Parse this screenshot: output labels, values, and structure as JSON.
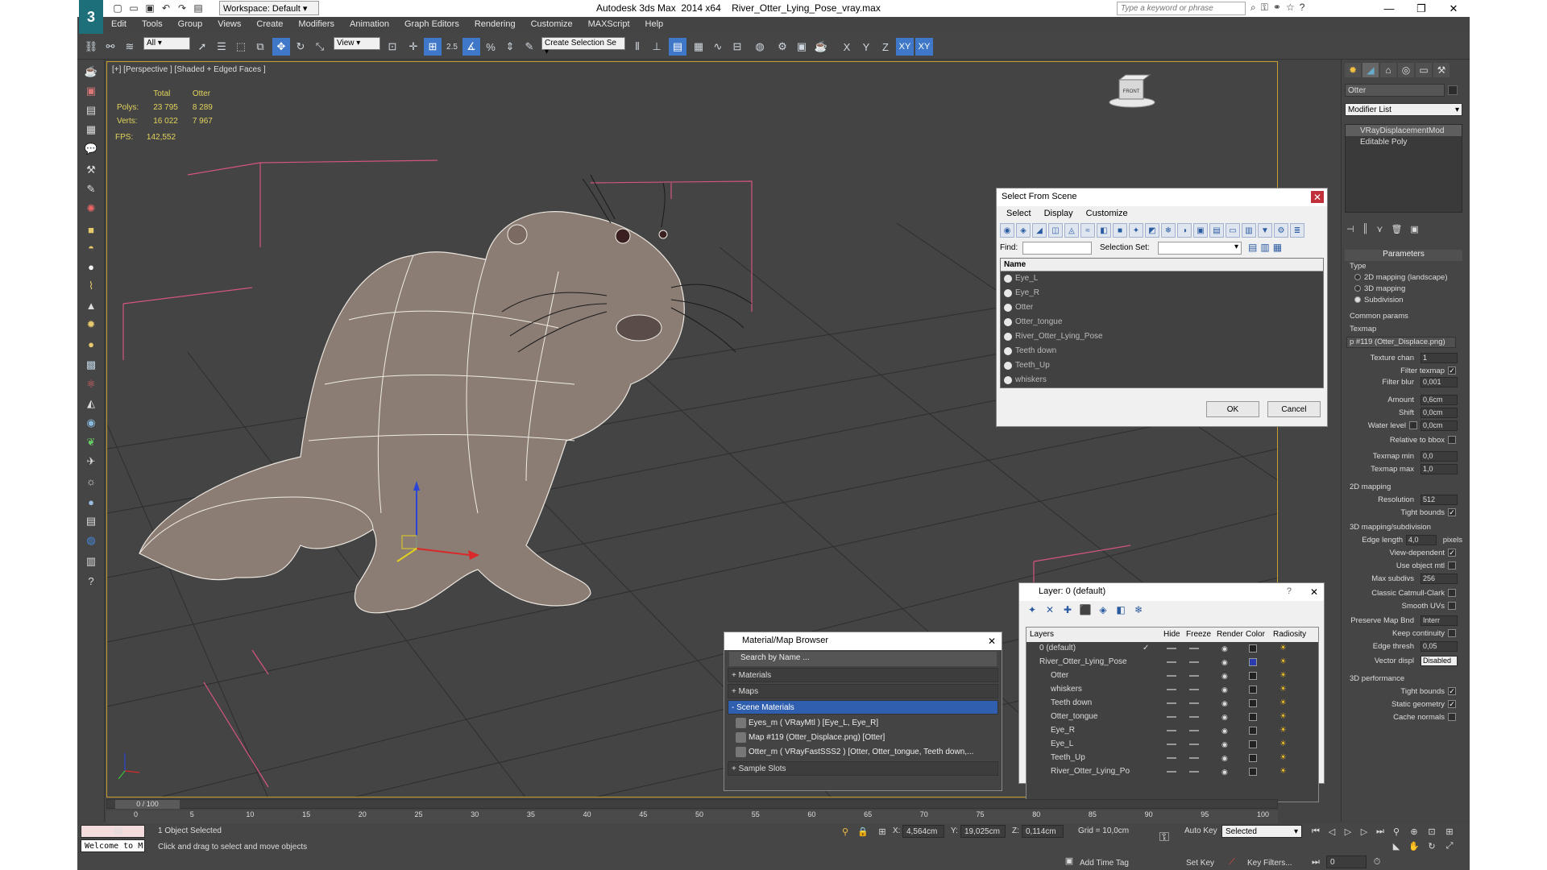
{
  "app": {
    "title": "Autodesk 3ds Max  2014 x64    River_Otter_Lying_Pose_vray.max",
    "workspace": "Workspace: Default",
    "search_placeholder": "Type a keyword or phrase",
    "logo": "3"
  },
  "menu": [
    "Edit",
    "Tools",
    "Group",
    "Views",
    "Create",
    "Modifiers",
    "Animation",
    "Graph Editors",
    "Rendering",
    "Customize",
    "MAXScript",
    "Help"
  ],
  "toolbar": {
    "filter_select": "All",
    "coord_select": "View",
    "selection_set": "Create Selection Se",
    "snap_label": "2.5",
    "axes": [
      "X",
      "Y",
      "Z",
      "XY",
      "XY"
    ]
  },
  "viewport": {
    "label": "[+] [Perspective ] [Shaded + Edged Faces ]",
    "stats_headers": [
      "Total",
      "Otter"
    ],
    "stats": [
      {
        "label": "Polys:",
        "total": "23 795",
        "sel": "8 289"
      },
      {
        "label": "Verts:",
        "total": "16 022",
        "sel": "7 967"
      }
    ],
    "fps_label": "FPS:",
    "fps_value": "142,552",
    "viewcube_label": "FRONT"
  },
  "select_from_scene": {
    "title": "Select From Scene",
    "menu": [
      "Select",
      "Display",
      "Customize"
    ],
    "find_label": "Find:",
    "selset_label": "Selection Set:",
    "column": "Name",
    "items": [
      "Eye_L",
      "Eye_R",
      "Otter",
      "Otter_tongue",
      "River_Otter_Lying_Pose",
      "Teeth down",
      "Teeth_Up",
      "whiskers"
    ],
    "ok": "OK",
    "cancel": "Cancel"
  },
  "material_browser": {
    "title": "Material/Map Browser",
    "search": "Search by Name ...",
    "groups": [
      "+ Materials",
      "+ Maps",
      "- Scene Materials"
    ],
    "items": [
      "Eyes_m  ( VRayMtl ) [Eye_L, Eye_R]",
      "Map #119 (Otter_Displace.png) [Otter]",
      "Otter_m  ( VRayFastSSS2 ) [Otter, Otter_tongue, Teeth down,..."
    ],
    "sample_slots": "+ Sample Slots"
  },
  "layer_dialog": {
    "title": "Layer: 0 (default)",
    "help": "?",
    "columns": [
      "Layers",
      "Hide",
      "Freeze",
      "Render",
      "Color",
      "Radiosity"
    ],
    "rows": [
      {
        "name": "0 (default)",
        "indent": 0,
        "check": "✓",
        "color": "#222222"
      },
      {
        "name": "River_Otter_Lying_Pose",
        "indent": 0,
        "check": "",
        "color": "#2b3bb0"
      },
      {
        "name": "Otter",
        "indent": 1,
        "check": "",
        "color": "#222222"
      },
      {
        "name": "whiskers",
        "indent": 1,
        "check": "",
        "color": "#222222"
      },
      {
        "name": "Teeth down",
        "indent": 1,
        "check": "",
        "color": "#222222"
      },
      {
        "name": "Otter_tongue",
        "indent": 1,
        "check": "",
        "color": "#222222"
      },
      {
        "name": "Eye_R",
        "indent": 1,
        "check": "",
        "color": "#222222"
      },
      {
        "name": "Eye_L",
        "indent": 1,
        "check": "",
        "color": "#222222"
      },
      {
        "name": "Teeth_Up",
        "indent": 1,
        "check": "",
        "color": "#222222"
      },
      {
        "name": "River_Otter_Lying_Po",
        "indent": 1,
        "check": "",
        "color": "#222222"
      }
    ]
  },
  "command_panel": {
    "object_name": "Otter",
    "modifier_list": "Modifier List",
    "stack": [
      "VRayDisplacementMod",
      "Editable Poly"
    ],
    "params_title": "Parameters",
    "type_label": "Type",
    "types": [
      {
        "label": "2D mapping (landscape)",
        "on": false
      },
      {
        "label": "3D mapping",
        "on": false
      },
      {
        "label": "Subdivision",
        "on": true
      }
    ],
    "common_params": "Common params",
    "texmap_label": "Texmap",
    "texmap_value": "p #119 (Otter_Displace.png)",
    "texture_chan": {
      "label": "Texture chan",
      "value": "1"
    },
    "filter_texmap": {
      "label": "Filter texmap",
      "checked": true
    },
    "filter_blur": {
      "label": "Filter blur",
      "value": "0,001"
    },
    "amount": {
      "label": "Amount",
      "value": "0,6cm"
    },
    "shift": {
      "label": "Shift",
      "value": "0,0cm"
    },
    "water_level": {
      "label": "Water level",
      "value": "0,0cm"
    },
    "relative_bbox": {
      "label": "Relative to bbox",
      "checked": false
    },
    "texmap_min": {
      "label": "Texmap min",
      "value": "0,0"
    },
    "texmap_max": {
      "label": "Texmap max",
      "value": "1,0"
    },
    "mapping2d": "2D mapping",
    "resolution": {
      "label": "Resolution",
      "value": "512"
    },
    "tight_bounds": {
      "label": "Tight bounds",
      "checked": true
    },
    "mapping3d": "3D mapping/subdivision",
    "edge_length": {
      "label": "Edge length",
      "value": "4,0",
      "unit": "pixels"
    },
    "view_dependent": {
      "label": "View-dependent",
      "checked": true
    },
    "use_object_mtl": {
      "label": "Use object mtl",
      "checked": false
    },
    "max_subdivs": {
      "label": "Max subdivs",
      "value": "256"
    },
    "catmull": {
      "label": "Classic Catmull-Clark",
      "checked": false
    },
    "smooth_uvs": {
      "label": "Smooth UVs",
      "checked": false
    },
    "preserve_map": {
      "label": "Preserve Map Bnd",
      "value": "Interr"
    },
    "keep_continuity": {
      "label": "Keep continuity",
      "checked": false
    },
    "edge_thresh": {
      "label": "Edge thresh",
      "value": "0,05"
    },
    "vector_displ": {
      "label": "Vector displ",
      "value": "Disabled"
    },
    "perf": "3D performance",
    "tight_bounds2": {
      "label": "Tight bounds",
      "checked": true
    },
    "static_geometry": {
      "label": "Static geometry",
      "checked": true
    },
    "cache_normals": {
      "label": "Cache normals",
      "checked": false
    }
  },
  "timeline": {
    "slider": "0 / 100",
    "ticks": [
      "0",
      "5",
      "10",
      "15",
      "20",
      "25",
      "30",
      "35",
      "40",
      "45",
      "50",
      "55",
      "60",
      "65",
      "70",
      "75",
      "80",
      "85",
      "90",
      "95",
      "100"
    ]
  },
  "status": {
    "maxscript": "Welcome to M",
    "selected": "1 Object Selected",
    "prompt": "Click and drag to select and move objects",
    "x_label": "X:",
    "x": "4,564cm",
    "y_label": "Y:",
    "y": "19,025cm",
    "z_label": "Z:",
    "z": "0,114cm",
    "grid": "Grid = 10,0cm",
    "auto_key": "Auto Key",
    "key_mode": "Selected",
    "set_key": "Set Key",
    "key_filters": "Key Filters...",
    "add_time_tag": "Add Time Tag",
    "frame": "0"
  }
}
